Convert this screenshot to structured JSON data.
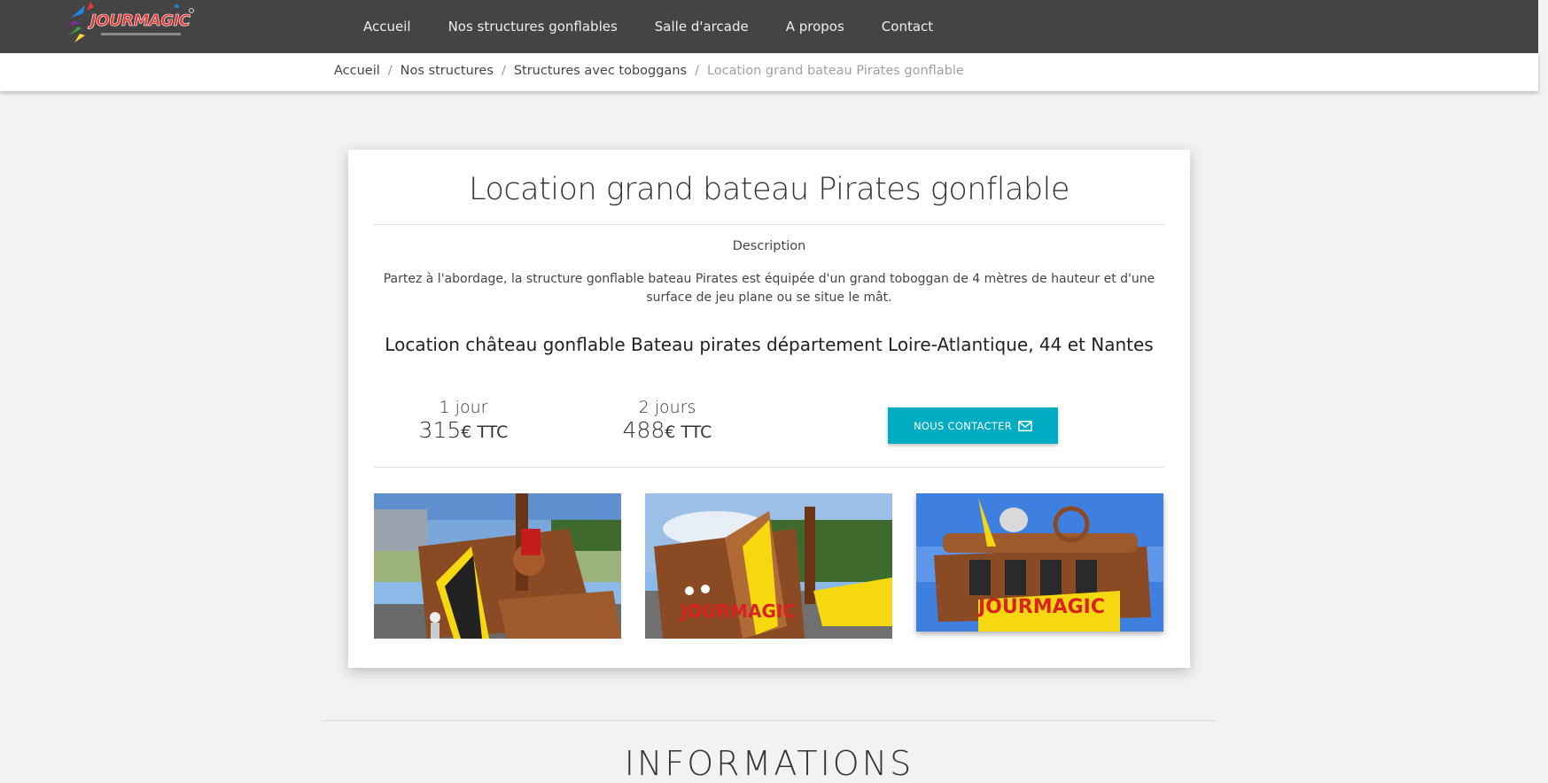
{
  "brand": {
    "logo_text": "JOURMAGIC"
  },
  "nav": {
    "items": [
      "Accueil",
      "Nos structures gonflables",
      "Salle d'arcade",
      "A propos",
      "Contact"
    ]
  },
  "breadcrumb": {
    "items": [
      "Accueil",
      "Nos structures",
      "Structures avec toboggans"
    ],
    "current": "Location grand bateau Pirates gonflable",
    "separator": "/"
  },
  "product": {
    "title": "Location grand bateau Pirates gonflable",
    "description_heading": "Description",
    "description": "Partez à l'abordage, la structure gonflable bateau Pirates est équipée d'un grand toboggan de 4 mètres de hauteur et d'une surface de jeu plane ou se situe le mât.",
    "subtitle": "Location château gonflable Bateau pirates département Loire-Atlantique, 44 et Nantes",
    "prices": [
      {
        "duration": "1 jour",
        "amount": "315",
        "unit": "€ TTC"
      },
      {
        "duration": "2 jours",
        "amount": "488",
        "unit": "€ TTC"
      }
    ],
    "contact_button": "NOUS CONTACTER",
    "photos": [
      "pirate-ship-photo-1",
      "pirate-ship-photo-2",
      "pirate-ship-photo-3"
    ]
  },
  "section": {
    "heading": "INFORMATIONS"
  },
  "colors": {
    "navbar": "#444444",
    "accent": "#00acc1",
    "background": "#f2f2f2"
  }
}
